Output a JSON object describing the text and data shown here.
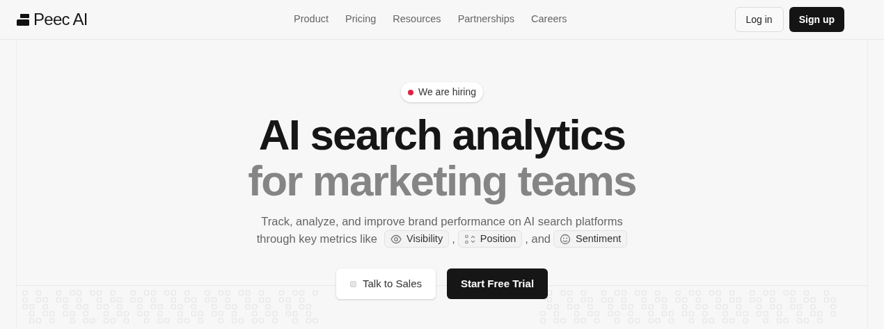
{
  "header": {
    "logo": "Peec AI",
    "nav": [
      "Product",
      "Pricing",
      "Resources",
      "Partnerships",
      "Careers"
    ],
    "login": "Log in",
    "signup": "Sign up"
  },
  "hero": {
    "badge": "We are hiring",
    "title_line_1": "AI search analytics",
    "title_line_2": "for marketing teams",
    "description": "Track, analyze, and improve brand performance on AI search platforms",
    "metrics_lead": "through key metrics like",
    "metrics": [
      {
        "kind": "eye",
        "label": "Visibility",
        "suffix": ","
      },
      {
        "kind": "dots",
        "label": "Position",
        "suffix": ", and"
      },
      {
        "kind": "smile",
        "label": "Sentiment"
      }
    ],
    "buttons": [
      {
        "kind": "secondary",
        "label": "Talk to Sales"
      },
      {
        "kind": "primary",
        "label": "Start Free Trial"
      }
    ]
  }
}
